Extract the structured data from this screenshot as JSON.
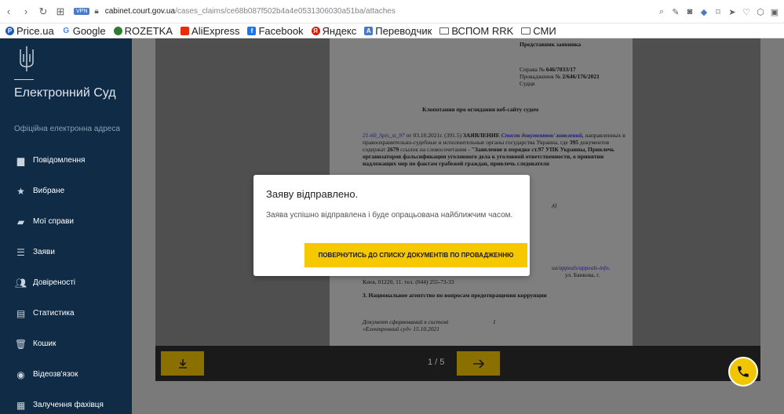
{
  "browser": {
    "vpn_label": "VPN",
    "url_host": "cabinet.court.gov.ua",
    "url_path": "/cases_claims/ce68b087f502b4a4e0531306030a51ba/attaches"
  },
  "bookmarks": [
    {
      "label": "Price.ua",
      "icon": "price-icon",
      "color": "#1a5cb8"
    },
    {
      "label": "Google",
      "icon": "google-icon",
      "color": "#4285f4"
    },
    {
      "label": "ROZETKA",
      "icon": "rozetka-icon",
      "color": "#2e7d32"
    },
    {
      "label": "AliExpress",
      "icon": "aliexpress-icon",
      "color": "#e62e04"
    },
    {
      "label": "Facebook",
      "icon": "facebook-icon",
      "color": "#1877f2"
    },
    {
      "label": "Яндекс",
      "icon": "yandex-icon",
      "color": "#e61400"
    },
    {
      "label": "Переводчик",
      "icon": "translate-icon",
      "color": "#4b79c9"
    },
    {
      "label": "ВСПОМ RRK",
      "icon": "folder-icon",
      "color": "#5f6368"
    },
    {
      "label": "СМИ",
      "icon": "folder-icon",
      "color": "#5f6368"
    }
  ],
  "sidebar": {
    "brand": "Електронний Суд",
    "subtitle": "Офіційна електронна адреса",
    "items": [
      {
        "label": "Повідомлення",
        "icon": "message-icon"
      },
      {
        "label": "Вибране",
        "icon": "star-icon"
      },
      {
        "label": "Мої справи",
        "icon": "folder-icon"
      },
      {
        "label": "Заяви",
        "icon": "list-icon"
      },
      {
        "label": "Довіреності",
        "icon": "users-icon"
      },
      {
        "label": "Статистика",
        "icon": "chart-icon"
      },
      {
        "label": "Кошик",
        "icon": "trash-icon"
      },
      {
        "label": "Відеозв'язок",
        "icon": "video-icon"
      },
      {
        "label": "Залучення фахівця",
        "icon": "specialist-icon"
      }
    ]
  },
  "document": {
    "line1": "Представник заявника",
    "case_label": "Справа №",
    "case_no": "646/7033/17",
    "proc_label": "Провадження №",
    "proc_no": "2/646/176/2021",
    "judge": "Судця",
    "title": "Клопотання про оглядання веб-сайту судом",
    "p1_ref": "21-60_Spis_st_97",
    "p1_date": "от 03.10.2021г. (391.5)",
    "p1_kw": "ЗАЯВЛЕНИЕ",
    "p1_link": "Список документов/",
    "p1_link2": "заявлений,",
    "p1_text": "направленных в правоохранительно-судебные и исполнительные органы государства Украина, где",
    "p1_n1": "395",
    "p1_mid": "документов содержат",
    "p1_n2": "2679",
    "p1_end": "ссылок на словосочетания",
    "p1_quote": "- \"Заявление в порядке ст.97 УПК Украины, Привлечь организаторов фальсификации уголовного дела к уголовной ответственности, о принятии надлежащих мер по фактам грабежей граждан, привлечь следователя",
    "p2_frag": "д)",
    "p3_link": "ua/appeals/appeals-info,",
    "p3_frag": "ул. Банкова, г.",
    "p3_addr": "Киев, 01220, 11. тел. (044) 255-73-33",
    "p4": "3.   Национальное агентство по вопросам предотвращения коррупции",
    "footer1": "Документ сформований в системі",
    "footer_num": "1",
    "footer2": "«Електронний суд» 15.10.2021"
  },
  "viewer": {
    "page_indicator": "1 / 5"
  },
  "modal": {
    "title": "Заяву відправлено.",
    "text": "Заява успішно відправлена і буде опрацьована найближчим часом.",
    "button": "ПОВЕРНУТИСЬ ДО СПИСКУ ДОКУМЕНТІВ ПО ПРОВАДЖЕННЮ"
  },
  "colors": {
    "sidebar_bg": "#0f2b45",
    "accent_yellow": "#f5c800"
  }
}
